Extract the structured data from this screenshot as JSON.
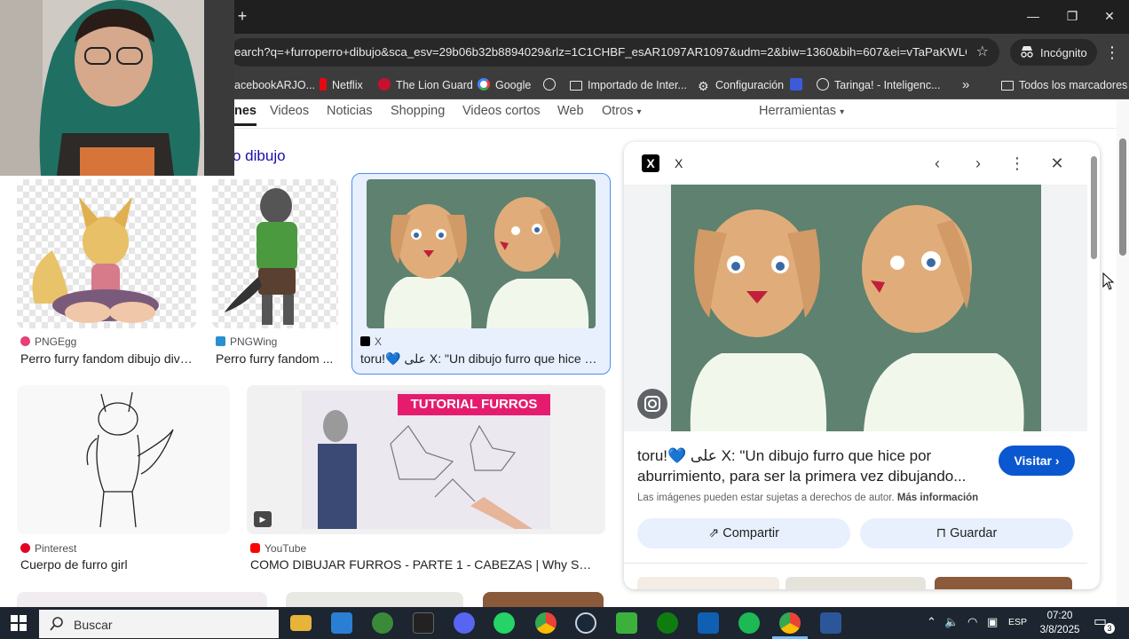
{
  "browser": {
    "url": "earch?q=+furroperro+dibujo&sca_esv=29b06b32b8894029&rlz=1C1CHBF_esAR1097AR1097&udm=2&biw=1360&bih=607&ei=vTaPaKWLG...",
    "incognito_label": "Incógnito",
    "bookmarks": [
      "acebookARJO...",
      "Netflix",
      "The Lion Guard",
      "Google",
      "",
      "Importado de Inter...",
      "Configuración",
      "",
      "Taringa! - Inteligenc..."
    ],
    "all_bookmarks": "Todos los marcadores",
    "overflow": "»"
  },
  "search": {
    "tabs": [
      "nes",
      "Videos",
      "Noticias",
      "Shopping",
      "Videos cortos",
      "Web",
      "Otros",
      "Herramientas"
    ],
    "query_title": "o dibujo"
  },
  "results": [
    {
      "source": "PNGEgg",
      "title": "Perro furry fandom dibujo dive..."
    },
    {
      "source": "PNGWing",
      "title": "Perro furry fandom ..."
    },
    {
      "source": "X",
      "title": "toru!💙 على X: \"Un dibujo furro que hice por..."
    },
    {
      "source": "Pinterest",
      "title": "Cuerpo de furro girl"
    },
    {
      "source": "YouTube",
      "title": "COMO DIBUJAR FURROS - PARTE 1 - CABEZAS | Why So G...",
      "overlay": "TUTORIAL FURROS"
    }
  ],
  "preview": {
    "source": "X",
    "title": "toru!💙 على X: \"Un dibujo furro que hice por aburrimiento, para ser la primera vez dibujando...",
    "visit_label": "Visitar",
    "rights_text": "Las imágenes pueden estar sujetas a derechos de autor.",
    "more_info": "Más información",
    "share_label": "Compartir",
    "save_label": "Guardar"
  },
  "taskbar": {
    "search_placeholder": "Buscar",
    "language": "ESP",
    "time": "07:20",
    "date": "3/8/2025",
    "notifications": "3"
  },
  "colors": {
    "link": "#1a0dab",
    "visit_button": "#0b57d0",
    "artwork_bg": "#5e8170",
    "dog_fur": "#e0ad7a"
  }
}
